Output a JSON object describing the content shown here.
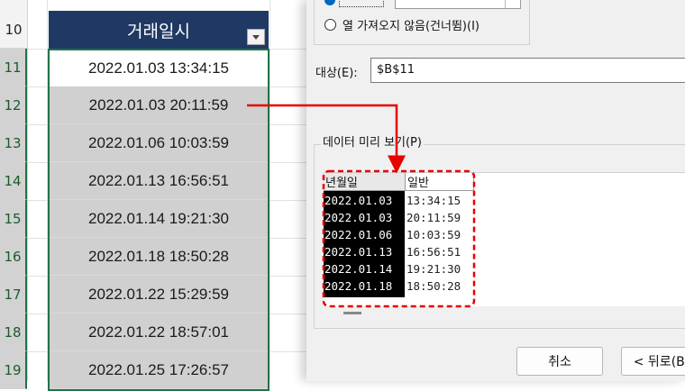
{
  "sheet": {
    "row_numbers": [
      "10",
      "11",
      "12",
      "13",
      "14",
      "15",
      "16",
      "17",
      "18",
      "19"
    ],
    "column_header": "거래일시",
    "cells": [
      "2022.01.03  13:34:15",
      "2022.01.03  20:11:59",
      "2022.01.06  10:03:59",
      "2022.01.13  16:56:51",
      "2022.01.14  19:21:30",
      "2022.01.18  18:50:28",
      "2022.01.22  15:29:59",
      "2022.01.22  18:57:01",
      "2022.01.25  17:26:57"
    ]
  },
  "dialog": {
    "radio_skip_label": "열 가져오지 않음(건너뜀)(I)",
    "target_label": "대상(E):",
    "target_value": "$B$11",
    "preview_title": "데이터 미리 보기(P)",
    "preview": {
      "headers": [
        "년월일",
        "일반"
      ],
      "rows": [
        [
          "2022.01.03",
          "13:34:15"
        ],
        [
          "2022.01.03",
          "20:11:59"
        ],
        [
          "2022.01.06",
          "10:03:59"
        ],
        [
          "2022.01.13",
          "16:56:51"
        ],
        [
          "2022.01.14",
          "19:21:30"
        ],
        [
          "2022.01.18",
          "18:50:28"
        ]
      ]
    },
    "cancel_label": "취소",
    "back_label": "< 뒤로(B)"
  },
  "annotation": {
    "arrow_color": "#e60000",
    "box_style": "dashed",
    "header_color": "#203864"
  }
}
